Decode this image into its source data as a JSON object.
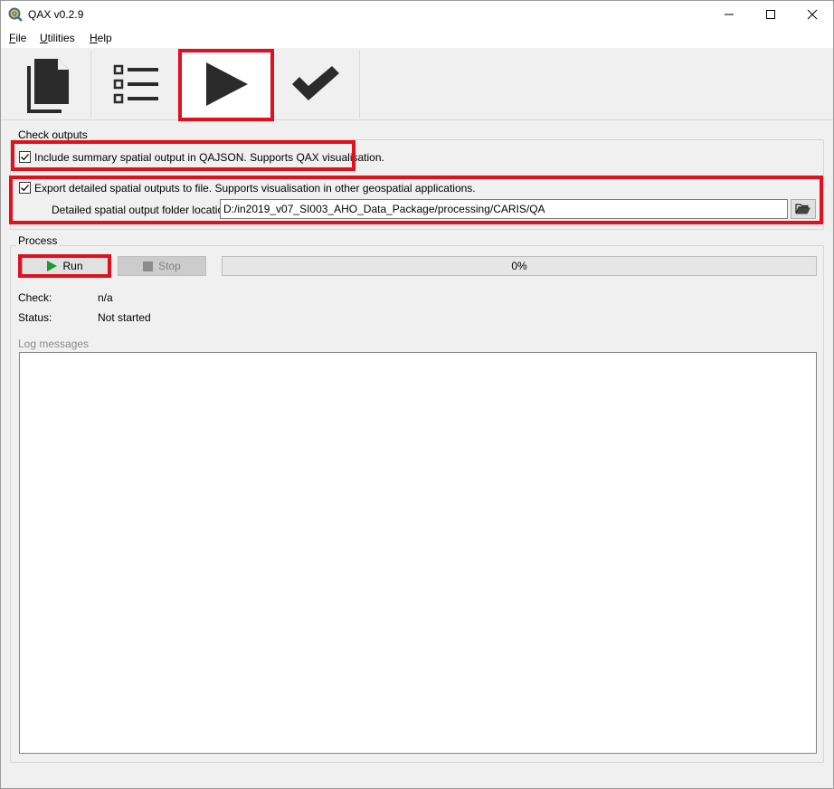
{
  "window": {
    "title": "QAX v0.2.9"
  },
  "menu": {
    "file": {
      "underline": "F",
      "rest": "ile"
    },
    "utilities": {
      "underline": "U",
      "rest": "tilities"
    },
    "help": {
      "underline": "H",
      "rest": "elp"
    }
  },
  "toolbar": {
    "tabs": [
      {
        "icon": "document-icon"
      },
      {
        "icon": "checklist-icon"
      },
      {
        "icon": "play-icon",
        "active": true
      },
      {
        "icon": "checkmark-icon"
      }
    ]
  },
  "check_outputs": {
    "title": "Check outputs",
    "include_summary": {
      "checked": true,
      "label": "Include summary spatial output in QAJSON. Supports QAX visualisation."
    },
    "export_detailed": {
      "checked": true,
      "label": "Export detailed spatial outputs to file. Supports visualisation in other geospatial applications."
    },
    "folder_label": "Detailed spatial output folder location:",
    "folder_value": "D:/in2019_v07_SI003_AHO_Data_Package/processing/CARIS/QA"
  },
  "process": {
    "title": "Process",
    "run_label": "Run",
    "stop_label": "Stop",
    "progress_text": "0%",
    "progress_value": 0,
    "check_label": "Check:",
    "check_value": "n/a",
    "status_label": "Status:",
    "status_value": "Not started",
    "log_label": "Log messages"
  },
  "colors": {
    "highlight": "#e0101e",
    "run_green": "#1a9a2a"
  }
}
